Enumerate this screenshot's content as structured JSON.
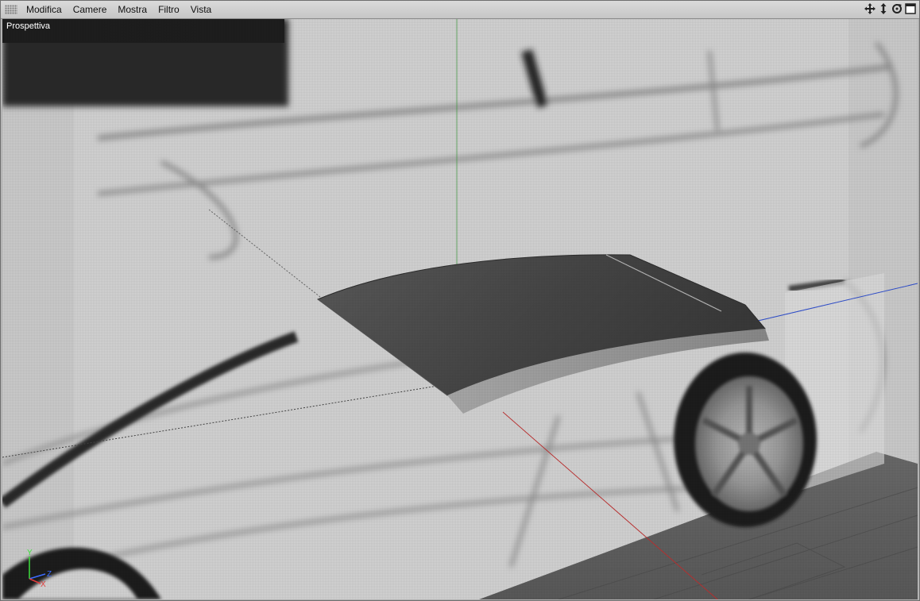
{
  "menu": {
    "items": [
      "Modifica",
      "Camere",
      "Mostra",
      "Filtro",
      "Vista"
    ]
  },
  "toolbar": {
    "icons": [
      "move-view-icon",
      "zoom-view-icon",
      "rotate-view-icon",
      "maximize-view-icon"
    ]
  },
  "viewport": {
    "label": "Prospettiva"
  },
  "axes": {
    "y_label": "Y",
    "z_label": "Z",
    "x_label": "X",
    "y_color": "#3ce03c",
    "z_color": "#3c6cff",
    "x_color": "#e03c3c"
  },
  "colors": {
    "background": "#cfcfcf",
    "surface_dark": "#4a4a4a",
    "surface_light": "#9a9a9a"
  }
}
